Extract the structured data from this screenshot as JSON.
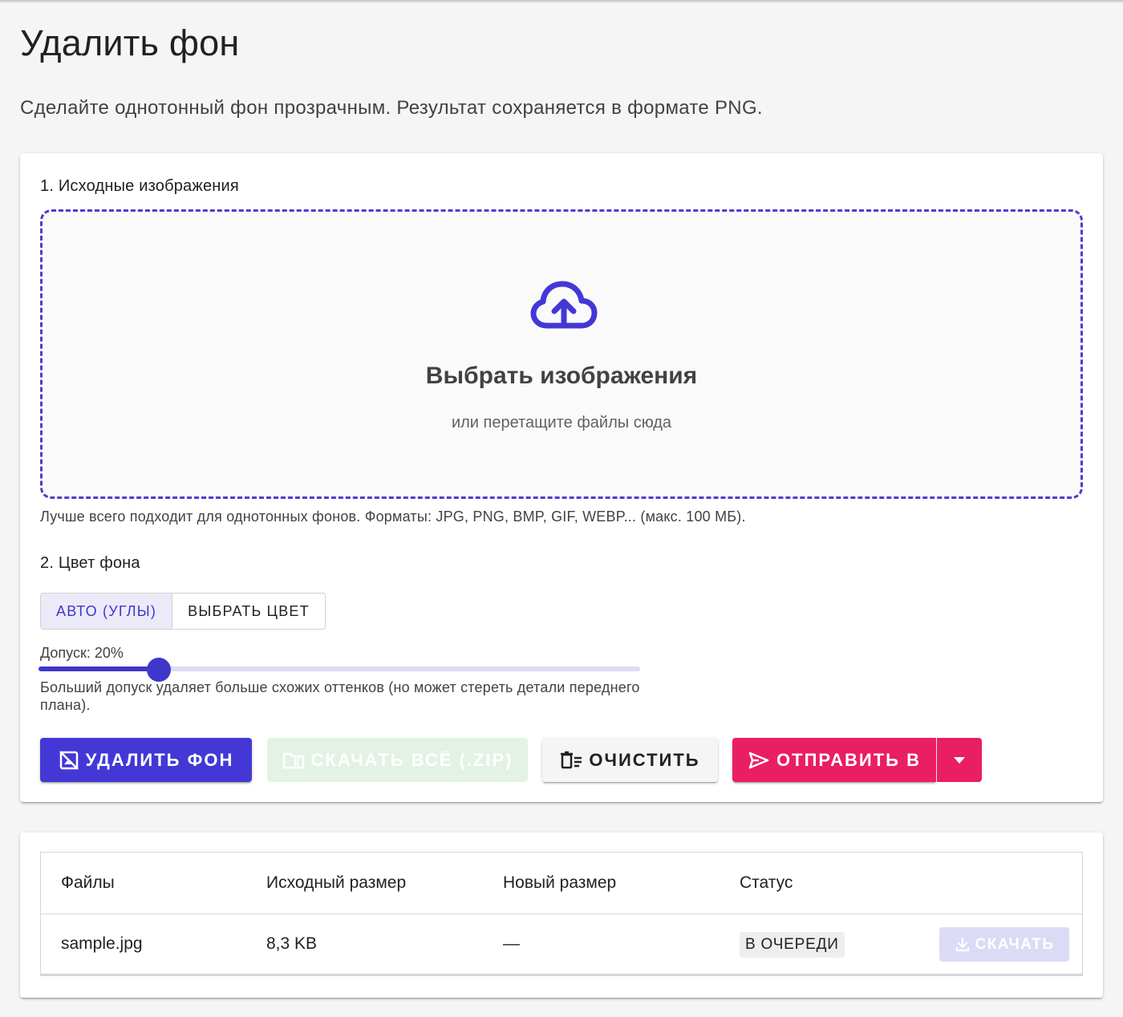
{
  "page": {
    "title": "Удалить фон",
    "subtitle": "Сделайте однотонный фон прозрачным. Результат сохраняется в формате PNG."
  },
  "source": {
    "section_title": "1. Исходные изображения",
    "dropzone_title": "Выбрать изображения",
    "dropzone_subtitle": "или перетащите файлы сюда",
    "hint": "Лучше всего подходит для однотонных фонов. Форматы: JPG, PNG, BMP, GIF, WEBP... (макс. 100 МБ).",
    "upload_icon": "cloud-upload-icon"
  },
  "background": {
    "section_title": "2. Цвет фона",
    "mode_auto": "Авто (углы)",
    "mode_pick": "Выбрать цвет",
    "selected_mode": "auto",
    "tolerance_label": "Допуск: 20%",
    "tolerance_value": 20,
    "tolerance_note": "Больший допуск удаляет больше схожих оттенков (но может стереть детали переднего плана)."
  },
  "actions": {
    "remove_label": "Удалить фон",
    "zip_label": "Скачать всё (.zip)",
    "clear_label": "Очистить",
    "send_label": "Отправить в",
    "remove_icon": "hide-image-icon",
    "zip_icon": "folder-zip-icon",
    "clear_icon": "clear-list-icon",
    "send_icon": "send-icon",
    "dropdown_icon": "caret-down-icon"
  },
  "table": {
    "headers": [
      "Файлы",
      "Исходный размер",
      "Новый размер",
      "Статус"
    ],
    "rows": [
      {
        "file": "sample.jpg",
        "original_size": "8,3 KB",
        "new_size": "—",
        "status": "В очереди",
        "download_label": "Скачать"
      }
    ]
  },
  "colors": {
    "primary": "#4338d6",
    "accent": "#e91e63",
    "zip_disabled": "#e3f2e5",
    "dropzone_border": "#4a3fcf"
  }
}
